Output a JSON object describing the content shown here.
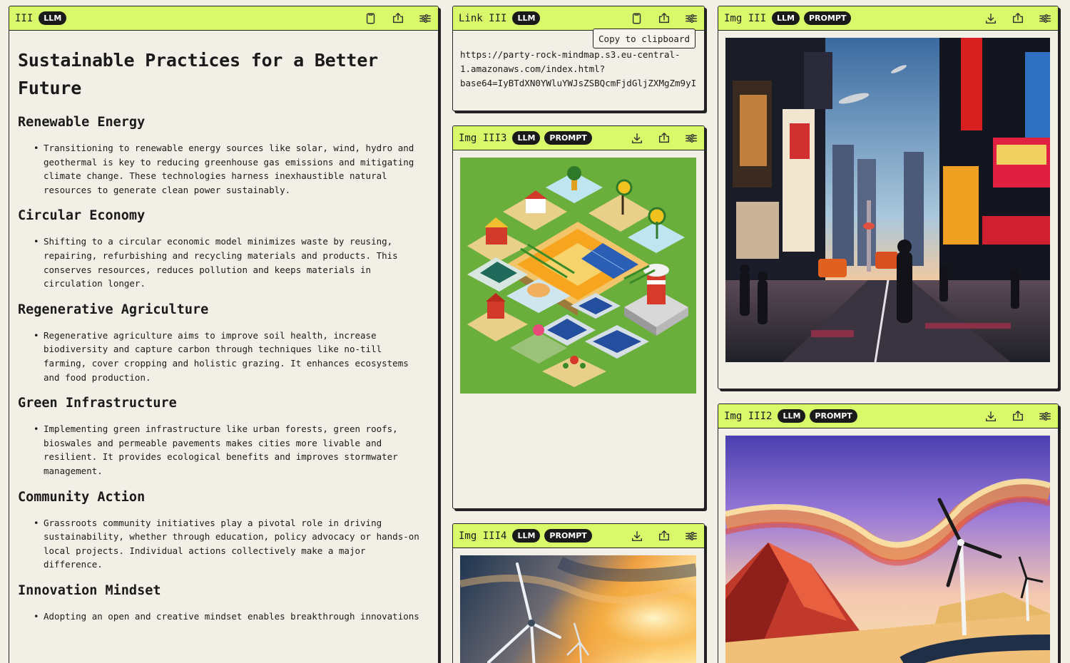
{
  "badges": {
    "llm": "LLM",
    "prompt": "PROMPT"
  },
  "text_panel": {
    "title": "III",
    "heading": "Sustainable Practices for a Better Future",
    "sections": [
      {
        "title": "Renewable Energy",
        "lines": [
          "Transitioning to renewable energy sources like solar, wind, hydro and",
          "geothermal is key to reducing greenhouse gas emissions and mitigating",
          "climate change. These technologies harness inexhaustible natural",
          "resources to generate clean power sustainably."
        ]
      },
      {
        "title": "Circular Economy",
        "lines": [
          "Shifting to a circular economic model minimizes waste by reusing,",
          "repairing, refurbishing and recycling materials and products. This",
          "conserves resources, reduces pollution and keeps materials in",
          "circulation longer."
        ]
      },
      {
        "title": "Regenerative Agriculture",
        "lines": [
          "Regenerative agriculture aims to improve soil health, increase",
          "biodiversity and capture carbon through techniques like no-till",
          "farming, cover cropping and holistic grazing. It enhances ecosystems",
          "and food production."
        ]
      },
      {
        "title": "Green Infrastructure",
        "lines": [
          "Implementing green infrastructure like urban forests, green roofs,",
          "bioswales and permeable pavements makes cities more livable and",
          "resilient. It provides ecological benefits and improves stormwater",
          "management."
        ]
      },
      {
        "title": "Community Action",
        "lines": [
          "Grassroots community initiatives play a pivotal role in driving",
          "sustainability, whether through education, policy advocacy or hands-on",
          "local projects. Individual actions collectively make a major",
          "difference."
        ]
      },
      {
        "title": "Innovation Mindset",
        "lines": [
          "Adopting an open and creative mindset enables breakthrough innovations"
        ]
      }
    ]
  },
  "link_panel": {
    "title": "Link III",
    "url_lines": [
      "https://party-rock-mindmap.s3.eu-central-",
      "1.amazonaws.com/index.html?",
      "base64=IyBTdXN0YWluYWJsZSBQcmFjdGljZXMgZm9yI"
    ],
    "tooltip": "Copy to clipboard"
  },
  "img3_panel": {
    "title": "Img III3"
  },
  "img4_panel": {
    "title": "Img III4"
  },
  "img1_panel": {
    "title": "Img III"
  },
  "img2_panel": {
    "title": "Img III2"
  },
  "icons": [
    "copy-icon",
    "export-icon",
    "settings-sliders-icon",
    "download-icon"
  ],
  "colors": {
    "header": "#d9f96a",
    "background": "#f2efe6",
    "badge": "#1a1a1a"
  }
}
